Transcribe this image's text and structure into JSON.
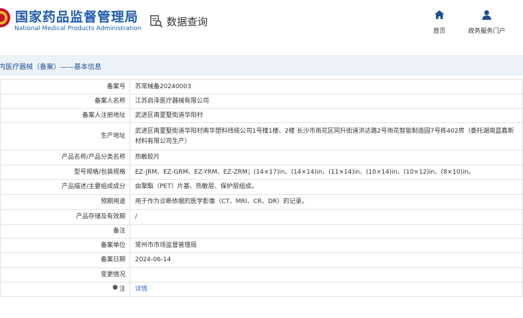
{
  "header": {
    "site_title": "国家药品监督管理局",
    "site_subtitle": "National Medical Products Administration",
    "module_label": "数据查询",
    "nav": [
      {
        "label": "首页",
        "icon": "home-icon"
      },
      {
        "label": "政务服务门户",
        "icon": "user-icon"
      }
    ]
  },
  "section": {
    "title": "内医疗器械（备案）——基本信息"
  },
  "record": [
    {
      "key": "备案号",
      "value": "苏常械备20240003"
    },
    {
      "key": "备案人名称",
      "value": "江苏启泽医疗器械有限公司"
    },
    {
      "key": "备案人注册地址",
      "value": "武进区南夏墅街道华阳村"
    },
    {
      "key": "生产地址",
      "value": "武进区南夏墅街道华阳村南华塑料线缆公司1号楼1楼、2楼 长沙市雨花区同升街道洪达路2号雨花智能制造园7号栋402房（委托湖南蓝鑫新材料有限公司生产）"
    },
    {
      "key": "产品名称/产品分类名称",
      "value": "热敏胶片"
    },
    {
      "key": "型号规格/包装规格",
      "value": "EZ-JRM、EZ-GRM、EZ-YRM、EZ-ZRM；(14×17)in、(14×14)in、(11×14)in、(10×14)in、(10×12)in、(8×10)in。"
    },
    {
      "key": "产品描述/主要组成成分",
      "value": "由聚酯（PET）片基、热敏层、保护层组成。"
    },
    {
      "key": "预期用途",
      "value": "用于作为诊断依据的医学影像（CT、MRI、CR、DR）的记录。"
    },
    {
      "key": "产品存储及有效期",
      "value": "/"
    },
    {
      "key": "备注",
      "value": ""
    },
    {
      "key": "备案单位",
      "value": "常州市市场监督管理局"
    },
    {
      "key": "备案日期",
      "value": "2024-06-14"
    },
    {
      "key": "变更情况",
      "value": ""
    },
    {
      "key": "注",
      "value": "详情"
    }
  ],
  "colors": {
    "brand_blue": "#1f5bb0",
    "section_bg": "#eef3fa",
    "link": "#2f6fc0"
  }
}
